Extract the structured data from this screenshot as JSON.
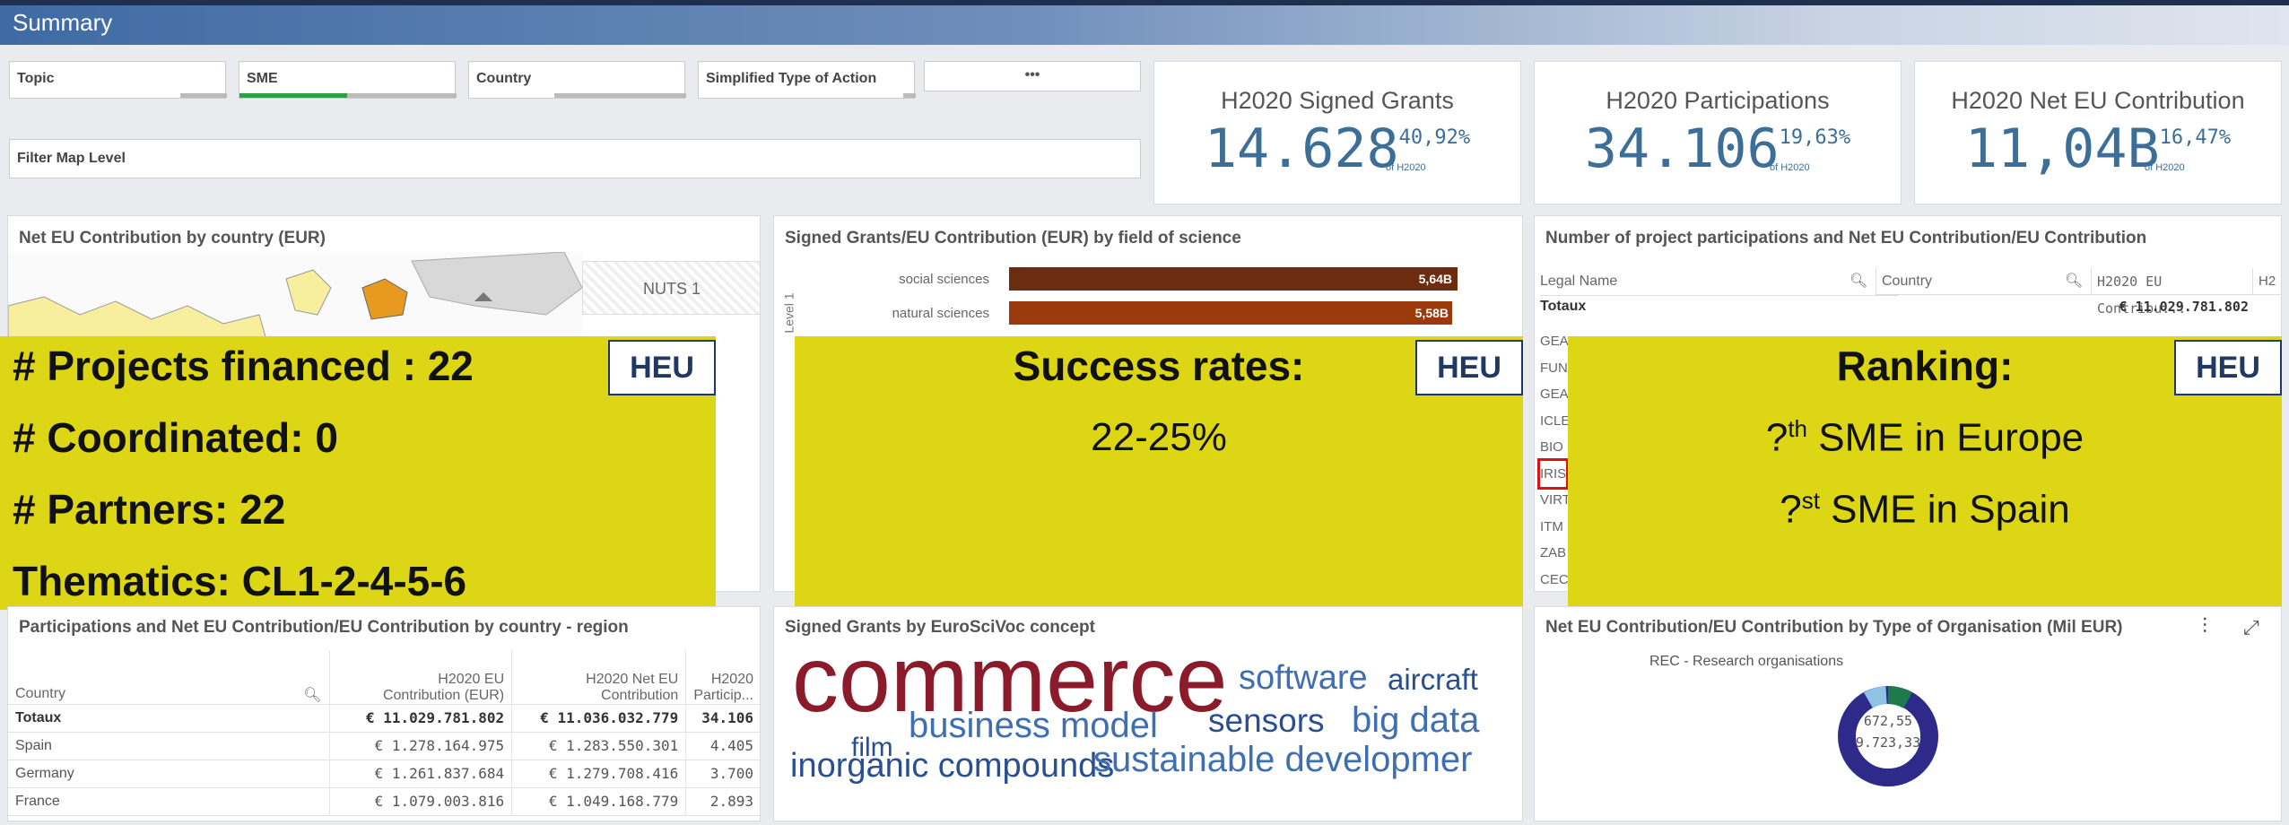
{
  "header": {
    "title": "Summary"
  },
  "filters": {
    "topic": "Topic",
    "sme": "SME",
    "country": "Country",
    "type_of_action": "Simplified Type of Action",
    "more": "•••",
    "map_level": "Filter Map Level"
  },
  "kpis": [
    {
      "title": "H2020 Signed Grants",
      "value": "14.628",
      "pct": "40,92%",
      "sub": "of H2020"
    },
    {
      "title": "H2020 Participations",
      "value": "34.106",
      "pct": "19,63%",
      "sub": "of H2020"
    },
    {
      "title": "H2020 Net EU Contribution",
      "value": "11,04B",
      "pct": "16,47%",
      "sub": "of H2020"
    }
  ],
  "map_panel": {
    "title": "Net EU Contribution by country (EUR)",
    "nuts": "NUTS 1"
  },
  "science_panel": {
    "title": "Signed Grants/EU Contribution (EUR) by field of science",
    "axis_label": "Level 1",
    "bars": [
      {
        "label": "social sciences",
        "value": "5,64B",
        "color": "#6b2c0f"
      },
      {
        "label": "natural sciences",
        "value": "5,58B",
        "color": "#9a3a0c"
      }
    ]
  },
  "participations_panel": {
    "title": "Number of project participations and Net EU Contribution/EU Contribution",
    "columns": [
      "Legal Name",
      "Country",
      "H2020 EU Contribu...",
      "H2"
    ],
    "total_label": "Totaux",
    "total_value": "€ 11.029.781.802",
    "rows": [
      "GEA",
      "FUN",
      "GEA",
      "ICLE",
      "BIO",
      "IRIS",
      "VIRT",
      "ITM",
      "ZAB",
      "CEC"
    ]
  },
  "overlay_left": {
    "lines": [
      "# Projects financed : 22",
      "# Coordinated: 0",
      "# Partners: 22",
      "Thematics: CL1-2-4-5-6"
    ],
    "badge": "HEU"
  },
  "overlay_mid": {
    "title": "Success rates:",
    "value": "22-25%",
    "badge": "HEU"
  },
  "overlay_right": {
    "title": "Ranking:",
    "line1_prefix": "?",
    "line1_sup": "th",
    "line1_rest": " SME in Europe",
    "line2_prefix": "?",
    "line2_sup": "st",
    "line2_rest": " SME in Spain",
    "badge": "HEU"
  },
  "country_panel": {
    "title": "Participations and Net EU Contribution/EU Contribution by country - region",
    "columns": [
      "Country",
      "H2020 EU\nContribution (EUR)",
      "H2020 Net EU\nContribution",
      "H2020\nParticip..."
    ],
    "total": [
      "Totaux",
      "€ 11.029.781.802",
      "€ 11.036.032.779",
      "34.106"
    ],
    "rows": [
      [
        "Spain",
        "€ 1.278.164.975",
        "€ 1.283.550.301",
        "4.405"
      ],
      [
        "Germany",
        "€ 1.261.837.684",
        "€ 1.279.708.416",
        "3.700"
      ],
      [
        "France",
        "€ 1.079.003.816",
        "€ 1.049.168.779",
        "2.893"
      ]
    ]
  },
  "wordcloud_panel": {
    "title": "Signed Grants by EuroSciVoc concept",
    "words": [
      "commerce",
      "software",
      "aircraft",
      "business model",
      "sensors",
      "big data",
      "film",
      "inorganic compounds",
      "sustainable developmer"
    ]
  },
  "org_panel": {
    "title": "Net EU Contribution/EU Contribution by Type of Organisation (Mil EUR)",
    "legend": "REC - Research organisations",
    "value1": "672,55",
    "value2": "9.723,33"
  }
}
